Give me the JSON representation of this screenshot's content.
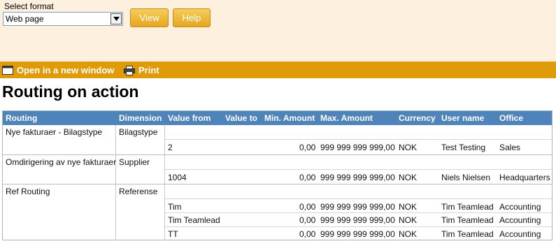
{
  "format": {
    "label": "Select format",
    "selected": "Web page"
  },
  "buttons": {
    "view": "View",
    "help": "Help"
  },
  "toolbar": {
    "open_new_window": "Open in a new window",
    "print": "Print"
  },
  "page_title": "Routing on action",
  "table": {
    "columns": [
      "Routing",
      "Dimension",
      "Value from",
      "Value to",
      "Min. Amount",
      "Max. Amount",
      "Currency",
      "User name",
      "Office"
    ],
    "groups": [
      {
        "routing": "Nye fakturaer - Bilagstype",
        "dimension": "Bilagstype",
        "rows": [
          {
            "value_from": "2",
            "value_to": "",
            "min": "0,00",
            "max": "999 999 999 999,00",
            "currency": "NOK",
            "user": "Test Testing",
            "office": "Sales"
          }
        ]
      },
      {
        "routing": "Omdirigering av nye fakturaer",
        "dimension": "Supplier",
        "rows": [
          {
            "value_from": "1004",
            "value_to": "",
            "min": "0,00",
            "max": "999 999 999 999,00",
            "currency": "NOK",
            "user": "Niels Nielsen",
            "office": "Headquarters"
          }
        ]
      },
      {
        "routing": "Ref Routing",
        "dimension": "Referense",
        "rows": [
          {
            "value_from": "Tim",
            "value_to": "",
            "min": "0,00",
            "max": "999 999 999 999,00",
            "currency": "NOK",
            "user": "Tim Teamlead",
            "office": "Accounting"
          },
          {
            "value_from": "Tim Teamlead",
            "value_to": "",
            "min": "0,00",
            "max": "999 999 999 999,00",
            "currency": "NOK",
            "user": "Tim Teamlead",
            "office": "Accounting"
          },
          {
            "value_from": "TT",
            "value_to": "",
            "min": "0,00",
            "max": "999 999 999 999,00",
            "currency": "NOK",
            "user": "Tim Teamlead",
            "office": "Accounting"
          }
        ]
      }
    ]
  }
}
